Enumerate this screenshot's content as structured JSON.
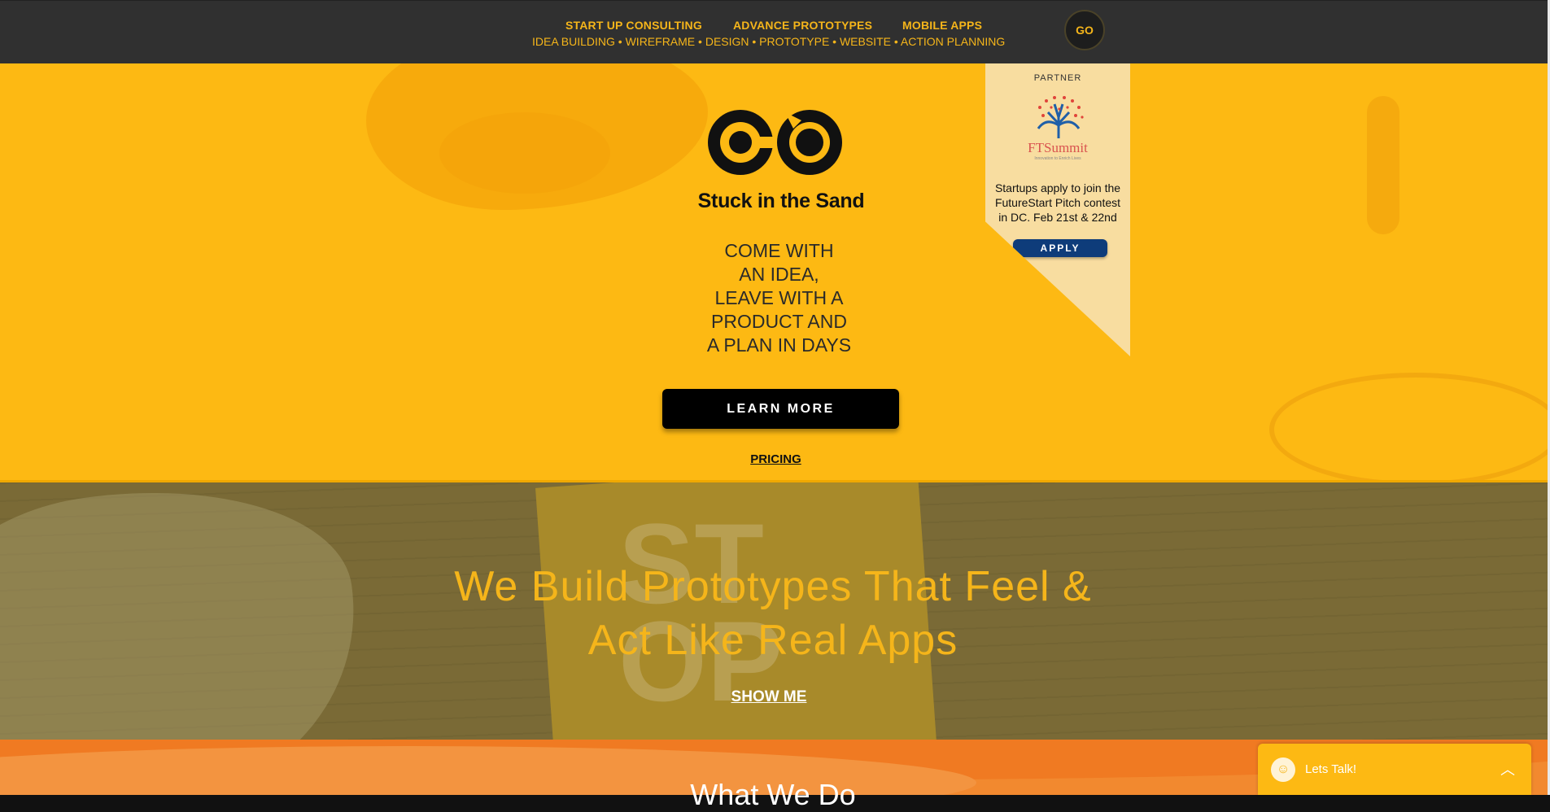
{
  "nav": {
    "links": [
      "START UP CONSULTING",
      "ADVANCE PROTOTYPES",
      "MOBILE APPS"
    ],
    "subline": "IDEA BUILDING  • WIREFRAME • DESIGN • PROTOTYPE • WEBSITE • ACTION PLANNING",
    "go_label": "GO"
  },
  "hero": {
    "brand": "Stuck in the Sand",
    "tagline": [
      "COME WITH",
      "AN IDEA,",
      "LEAVE WITH A",
      "PRODUCT AND",
      "A PLAN IN DAYS"
    ],
    "cta_label": "LEARN MORE",
    "pricing_label": "PRICING"
  },
  "partner": {
    "label": "PARTNER",
    "logo_text": "FTSummit",
    "logo_subtext": "Innovation to Enrich Lives",
    "text": "Startups apply to join the FutureStart Pitch contest in DC. Feb 21st & 22nd",
    "apply_label": "APPLY"
  },
  "prototypes": {
    "headline_line1": "We Build Prototypes That Feel &",
    "headline_line2": "Act Like Real Apps",
    "link_label": "SHOW ME"
  },
  "what_we_do": {
    "title": "What We Do"
  },
  "chat": {
    "label": "Lets Talk!",
    "avatar_icon": "smiley-icon",
    "chevron_icon": "chevron-up-icon"
  },
  "colors": {
    "brand_yellow": "#fdb913",
    "nav_bg": "#303030",
    "accent_text": "#f5b51a",
    "apply_blue": "#0e3c7a",
    "orange": "#f2892f"
  }
}
